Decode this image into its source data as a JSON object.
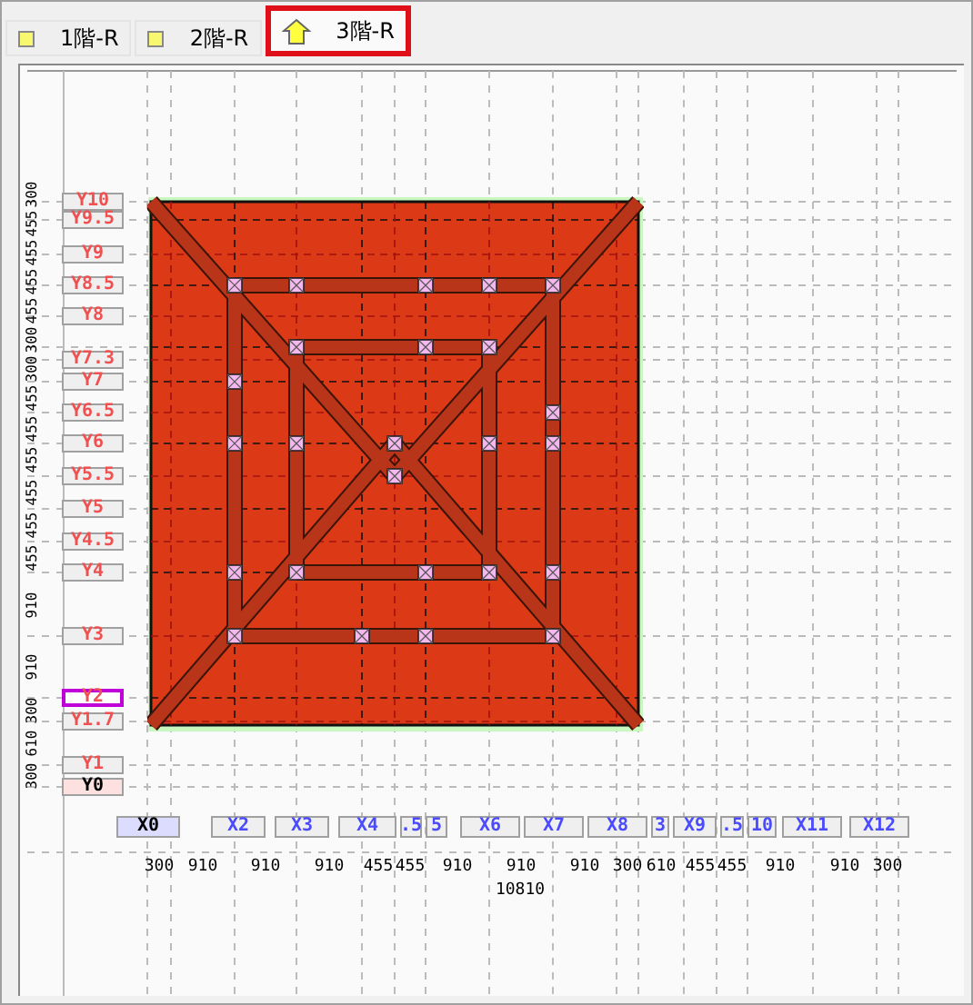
{
  "tabs": [
    {
      "label": "1階-R",
      "kind": "plain",
      "selected": false
    },
    {
      "label": "2階-R",
      "kind": "plain",
      "selected": false
    },
    {
      "label": "3階-R",
      "kind": "current",
      "selected": true
    }
  ],
  "y_axis": [
    {
      "label": "Y10",
      "kind": "grid",
      "selected": false
    },
    {
      "label": "Y9.5",
      "kind": "grid",
      "selected": false
    },
    {
      "label": "Y9",
      "kind": "grid",
      "selected": false
    },
    {
      "label": "Y8.5",
      "kind": "grid",
      "selected": false
    },
    {
      "label": "Y8",
      "kind": "grid",
      "selected": false
    },
    {
      "label": "Y7.3",
      "kind": "grid",
      "selected": false
    },
    {
      "label": "Y7",
      "kind": "grid",
      "selected": false
    },
    {
      "label": "Y6.5",
      "kind": "grid",
      "selected": false
    },
    {
      "label": "Y6",
      "kind": "grid",
      "selected": false
    },
    {
      "label": "Y5.5",
      "kind": "grid",
      "selected": false
    },
    {
      "label": "Y5",
      "kind": "grid",
      "selected": false
    },
    {
      "label": "Y4.5",
      "kind": "grid",
      "selected": false
    },
    {
      "label": "Y4",
      "kind": "grid",
      "selected": false
    },
    {
      "label": "Y3",
      "kind": "grid",
      "selected": false
    },
    {
      "label": "Y2",
      "kind": "grid",
      "selected": true
    },
    {
      "label": "Y1.7",
      "kind": "grid",
      "selected": false
    },
    {
      "label": "Y1",
      "kind": "grid",
      "selected": false
    },
    {
      "label": "Y0",
      "kind": "origin",
      "selected": false
    }
  ],
  "y_dimensions": [
    "300",
    "455",
    "455",
    "455",
    "455",
    "300",
    "300",
    "455",
    "455",
    "455",
    "455",
    "455",
    "455",
    "910",
    "910",
    "300",
    "610",
    "300"
  ],
  "x_axis": [
    {
      "label": "X0",
      "kind": "origin",
      "selected": false
    },
    {
      "label": "X2",
      "kind": "grid",
      "selected": false
    },
    {
      "label": "X3",
      "kind": "grid",
      "selected": false
    },
    {
      "label": "X4",
      "kind": "grid",
      "selected": false
    },
    {
      "label": ".5",
      "kind": "grid",
      "selected": false
    },
    {
      "label": "5",
      "kind": "grid",
      "selected": false
    },
    {
      "label": "X6",
      "kind": "grid",
      "selected": false
    },
    {
      "label": "X7",
      "kind": "grid",
      "selected": false
    },
    {
      "label": "X8",
      "kind": "grid",
      "selected": false
    },
    {
      "label": "3",
      "kind": "grid",
      "selected": false
    },
    {
      "label": "X9",
      "kind": "grid",
      "selected": false
    },
    {
      "label": ".5",
      "kind": "grid",
      "selected": false
    },
    {
      "label": "10",
      "kind": "grid",
      "selected": false
    },
    {
      "label": "X11",
      "kind": "grid",
      "selected": false
    },
    {
      "label": "X12",
      "kind": "grid",
      "selected": false
    }
  ],
  "x_dimensions": [
    "300",
    "910",
    "910",
    "910",
    "455",
    "455",
    "910",
    "910",
    "910",
    "300",
    "610",
    "455",
    "455",
    "910",
    "910",
    "300"
  ],
  "x_total": "10810"
}
